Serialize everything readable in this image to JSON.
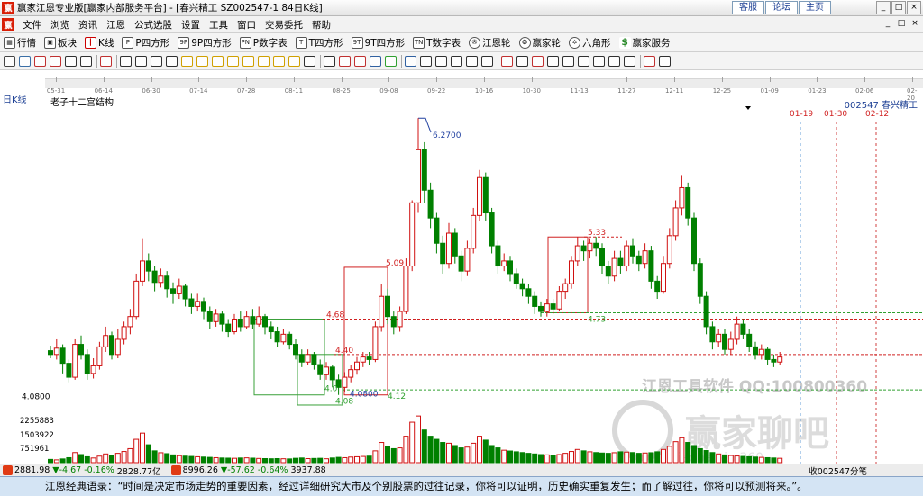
{
  "window": {
    "title": "赢家江恩专业版[赢家内部服务平台] - [春兴精工  SZ002547-1 84日K线]",
    "links": [
      "客服",
      "论坛",
      "主页"
    ],
    "controls": [
      "_",
      "□",
      "×"
    ]
  },
  "menu": {
    "items": [
      "文件",
      "浏览",
      "资讯",
      "江恩",
      "公式选股",
      "设置",
      "工具",
      "窗口",
      "交易委托",
      "帮助"
    ],
    "mdi_controls": [
      "_",
      "□",
      "×"
    ]
  },
  "toolbar": {
    "items": [
      {
        "icon": "grid",
        "label": "行情"
      },
      {
        "icon": "blocks",
        "label": "板块"
      },
      {
        "icon": "kline",
        "label": "K线"
      },
      {
        "icon": "P四",
        "label": "P四方形"
      },
      {
        "icon": "9P",
        "label": "9P四方形"
      },
      {
        "icon": "PN",
        "label": "P数字表"
      },
      {
        "icon": "T",
        "label": "T四方形"
      },
      {
        "icon": "9T",
        "label": "9T四方形"
      },
      {
        "icon": "TN",
        "label": "T数字表"
      },
      {
        "icon": "wheel",
        "label": "江恩轮"
      },
      {
        "icon": "wheel2",
        "label": "赢家轮"
      },
      {
        "icon": "hexagon",
        "label": "六角形"
      },
      {
        "icon": "dollar",
        "label": "赢家服务"
      }
    ]
  },
  "time_axis": {
    "labels": [
      "05-31",
      "06-14",
      "06-30",
      "07-14",
      "07-28",
      "08-11",
      "08-25",
      "09-08",
      "09-22",
      "10-16",
      "10-30",
      "11-13",
      "11-27",
      "12-11",
      "12-25",
      "01-09",
      "01-23",
      "02-06",
      "02-20"
    ]
  },
  "chart": {
    "period": "日K线",
    "indicator_name": "老子十二宫结构",
    "stock": "002547 春兴精工",
    "high_label": "6.2700",
    "low_label": "4.0800",
    "left_price": "4.0800",
    "dates_right": [
      "01-19",
      "01-30",
      "02-12"
    ],
    "levels": [
      "5.09",
      "4.68",
      "4.40",
      "4.08",
      "4.12",
      "5.33",
      "4.73",
      "4.0"
    ],
    "volume_labels": [
      "2255883",
      "1503922",
      "751961"
    ],
    "watermark": "江恩工具软件  QQ:100800360",
    "forum_watermark": "赢家聊吧",
    "forum_url_fragment": "liaoba.vip.360",
    "colors": {
      "up": "#d01010",
      "down": "#008000",
      "green_box": "#3aa03a",
      "red_box": "#d02020",
      "blue": "#2040a0"
    }
  },
  "chart_data": {
    "type": "candlestick",
    "ticker": "002547",
    "name": "春兴精工",
    "period": "日K线",
    "candles": [
      {
        "o": 4.43,
        "c": 4.4,
        "h": 4.47,
        "l": 4.37
      },
      {
        "o": 4.4,
        "c": 4.45,
        "h": 4.52,
        "l": 4.36
      },
      {
        "o": 4.45,
        "c": 4.33,
        "h": 4.48,
        "l": 4.25
      },
      {
        "o": 4.33,
        "c": 4.22,
        "h": 4.36,
        "l": 4.18
      },
      {
        "o": 4.22,
        "c": 4.48,
        "h": 4.52,
        "l": 4.2
      },
      {
        "o": 4.48,
        "c": 4.4,
        "h": 4.55,
        "l": 4.36
      },
      {
        "o": 4.4,
        "c": 4.25,
        "h": 4.44,
        "l": 4.2
      },
      {
        "o": 4.25,
        "c": 4.31,
        "h": 4.37,
        "l": 4.21
      },
      {
        "o": 4.31,
        "c": 4.46,
        "h": 4.5,
        "l": 4.28
      },
      {
        "o": 4.46,
        "c": 4.55,
        "h": 4.62,
        "l": 4.42
      },
      {
        "o": 4.55,
        "c": 4.4,
        "h": 4.58,
        "l": 4.36
      },
      {
        "o": 4.4,
        "c": 4.52,
        "h": 4.6,
        "l": 4.37
      },
      {
        "o": 4.52,
        "c": 4.62,
        "h": 4.66,
        "l": 4.48
      },
      {
        "o": 4.62,
        "c": 4.7,
        "h": 4.76,
        "l": 4.56
      },
      {
        "o": 4.7,
        "c": 4.98,
        "h": 5.04,
        "l": 4.68
      },
      {
        "o": 4.98,
        "c": 5.14,
        "h": 5.32,
        "l": 4.94
      },
      {
        "o": 5.14,
        "c": 5.06,
        "h": 5.2,
        "l": 4.98
      },
      {
        "o": 5.06,
        "c": 4.97,
        "h": 5.1,
        "l": 4.9
      },
      {
        "o": 4.97,
        "c": 5.02,
        "h": 5.08,
        "l": 4.93
      },
      {
        "o": 5.02,
        "c": 4.92,
        "h": 5.06,
        "l": 4.85
      },
      {
        "o": 4.92,
        "c": 4.88,
        "h": 4.97,
        "l": 4.8
      },
      {
        "o": 4.88,
        "c": 4.94,
        "h": 5.0,
        "l": 4.84
      },
      {
        "o": 4.94,
        "c": 4.84,
        "h": 4.96,
        "l": 4.78
      },
      {
        "o": 4.84,
        "c": 4.78,
        "h": 4.88,
        "l": 4.72
      },
      {
        "o": 4.78,
        "c": 4.82,
        "h": 4.88,
        "l": 4.74
      },
      {
        "o": 4.82,
        "c": 4.74,
        "h": 4.85,
        "l": 4.68
      },
      {
        "o": 4.74,
        "c": 4.66,
        "h": 4.78,
        "l": 4.6
      },
      {
        "o": 4.66,
        "c": 4.72,
        "h": 4.76,
        "l": 4.62
      },
      {
        "o": 4.72,
        "c": 4.64,
        "h": 4.74,
        "l": 4.58
      },
      {
        "o": 4.64,
        "c": 4.58,
        "h": 4.68,
        "l": 4.54
      },
      {
        "o": 4.58,
        "c": 4.68,
        "h": 4.72,
        "l": 4.56
      },
      {
        "o": 4.68,
        "c": 4.62,
        "h": 4.74,
        "l": 4.58
      },
      {
        "o": 4.62,
        "c": 4.7,
        "h": 4.74,
        "l": 4.6
      },
      {
        "o": 4.7,
        "c": 4.64,
        "h": 4.76,
        "l": 4.6
      },
      {
        "o": 4.64,
        "c": 4.7,
        "h": 4.78,
        "l": 4.62
      },
      {
        "o": 4.7,
        "c": 4.62,
        "h": 4.72,
        "l": 4.56
      },
      {
        "o": 4.62,
        "c": 4.58,
        "h": 4.66,
        "l": 4.52
      },
      {
        "o": 4.58,
        "c": 4.5,
        "h": 4.62,
        "l": 4.46
      },
      {
        "o": 4.5,
        "c": 4.56,
        "h": 4.6,
        "l": 4.48
      },
      {
        "o": 4.56,
        "c": 4.48,
        "h": 4.58,
        "l": 4.44
      },
      {
        "o": 4.48,
        "c": 4.4,
        "h": 4.52,
        "l": 4.36
      },
      {
        "o": 4.4,
        "c": 4.34,
        "h": 4.44,
        "l": 4.3
      },
      {
        "o": 4.34,
        "c": 4.4,
        "h": 4.44,
        "l": 4.32
      },
      {
        "o": 4.4,
        "c": 4.32,
        "h": 4.42,
        "l": 4.28
      },
      {
        "o": 4.32,
        "c": 4.24,
        "h": 4.36,
        "l": 4.2
      },
      {
        "o": 4.24,
        "c": 4.3,
        "h": 4.34,
        "l": 4.2
      },
      {
        "o": 4.3,
        "c": 4.2,
        "h": 4.32,
        "l": 4.14
      },
      {
        "o": 4.2,
        "c": 4.14,
        "h": 4.24,
        "l": 4.08
      },
      {
        "o": 4.14,
        "c": 4.22,
        "h": 4.26,
        "l": 4.1
      },
      {
        "o": 4.22,
        "c": 4.28,
        "h": 4.32,
        "l": 4.18
      },
      {
        "o": 4.28,
        "c": 4.34,
        "h": 4.38,
        "l": 4.24
      },
      {
        "o": 4.34,
        "c": 4.38,
        "h": 4.42,
        "l": 4.3
      },
      {
        "o": 4.38,
        "c": 4.36,
        "h": 4.42,
        "l": 4.32
      },
      {
        "o": 4.36,
        "c": 4.62,
        "h": 4.66,
        "l": 4.34
      },
      {
        "o": 4.62,
        "c": 4.86,
        "h": 4.96,
        "l": 4.58
      },
      {
        "o": 4.86,
        "c": 4.7,
        "h": 4.92,
        "l": 4.64
      },
      {
        "o": 4.7,
        "c": 4.62,
        "h": 4.74,
        "l": 4.56
      },
      {
        "o": 4.62,
        "c": 4.74,
        "h": 4.78,
        "l": 4.58
      },
      {
        "o": 4.74,
        "c": 5.1,
        "h": 5.16,
        "l": 4.72
      },
      {
        "o": 5.1,
        "c": 5.6,
        "h": 5.62,
        "l": 5.06
      },
      {
        "o": 5.6,
        "c": 6.02,
        "h": 6.27,
        "l": 5.52
      },
      {
        "o": 6.02,
        "c": 5.7,
        "h": 6.08,
        "l": 5.6
      },
      {
        "o": 5.7,
        "c": 5.48,
        "h": 5.76,
        "l": 5.4
      },
      {
        "o": 5.48,
        "c": 5.28,
        "h": 5.52,
        "l": 5.2
      },
      {
        "o": 5.28,
        "c": 5.12,
        "h": 5.34,
        "l": 5.04
      },
      {
        "o": 5.12,
        "c": 5.36,
        "h": 5.44,
        "l": 5.08
      },
      {
        "o": 5.36,
        "c": 5.18,
        "h": 5.4,
        "l": 5.12
      },
      {
        "o": 5.18,
        "c": 5.06,
        "h": 5.22,
        "l": 4.98
      },
      {
        "o": 5.06,
        "c": 5.24,
        "h": 5.3,
        "l": 5.02
      },
      {
        "o": 5.24,
        "c": 5.5,
        "h": 5.56,
        "l": 5.2
      },
      {
        "o": 5.5,
        "c": 5.8,
        "h": 5.86,
        "l": 5.46
      },
      {
        "o": 5.8,
        "c": 5.52,
        "h": 5.84,
        "l": 5.46
      },
      {
        "o": 5.52,
        "c": 5.26,
        "h": 5.56,
        "l": 5.2
      },
      {
        "o": 5.26,
        "c": 5.1,
        "h": 5.3,
        "l": 5.04
      },
      {
        "o": 5.1,
        "c": 5.14,
        "h": 5.2,
        "l": 5.06
      },
      {
        "o": 5.14,
        "c": 5.04,
        "h": 5.18,
        "l": 4.98
      },
      {
        "o": 5.04,
        "c": 4.96,
        "h": 5.08,
        "l": 4.92
      },
      {
        "o": 4.96,
        "c": 4.92,
        "h": 5.0,
        "l": 4.86
      },
      {
        "o": 4.92,
        "c": 4.86,
        "h": 4.96,
        "l": 4.8
      },
      {
        "o": 4.86,
        "c": 4.78,
        "h": 4.9,
        "l": 4.72
      },
      {
        "o": 4.78,
        "c": 4.74,
        "h": 4.82,
        "l": 4.7
      },
      {
        "o": 4.74,
        "c": 4.8,
        "h": 4.84,
        "l": 4.7
      },
      {
        "o": 4.8,
        "c": 4.76,
        "h": 4.84,
        "l": 4.72
      },
      {
        "o": 4.76,
        "c": 4.9,
        "h": 4.94,
        "l": 4.74
      },
      {
        "o": 4.9,
        "c": 4.96,
        "h": 5.0,
        "l": 4.84
      },
      {
        "o": 4.96,
        "c": 5.14,
        "h": 5.18,
        "l": 4.92
      },
      {
        "o": 5.14,
        "c": 5.26,
        "h": 5.33,
        "l": 5.1
      },
      {
        "o": 5.26,
        "c": 5.22,
        "h": 5.3,
        "l": 5.14
      },
      {
        "o": 5.22,
        "c": 5.28,
        "h": 5.32,
        "l": 5.16
      },
      {
        "o": 5.28,
        "c": 5.24,
        "h": 5.33,
        "l": 5.18
      },
      {
        "o": 5.24,
        "c": 5.1,
        "h": 5.28,
        "l": 5.04
      },
      {
        "o": 5.1,
        "c": 5.02,
        "h": 5.14,
        "l": 4.96
      },
      {
        "o": 5.02,
        "c": 5.16,
        "h": 5.22,
        "l": 4.98
      },
      {
        "o": 5.16,
        "c": 5.1,
        "h": 5.22,
        "l": 5.04
      },
      {
        "o": 5.1,
        "c": 5.26,
        "h": 5.3,
        "l": 5.06
      },
      {
        "o": 5.26,
        "c": 5.18,
        "h": 5.32,
        "l": 5.12
      },
      {
        "o": 5.18,
        "c": 5.12,
        "h": 5.22,
        "l": 5.06
      },
      {
        "o": 5.12,
        "c": 5.22,
        "h": 5.28,
        "l": 5.08
      },
      {
        "o": 5.22,
        "c": 4.98,
        "h": 5.26,
        "l": 4.92
      },
      {
        "o": 4.98,
        "c": 4.9,
        "h": 5.02,
        "l": 4.84
      },
      {
        "o": 4.9,
        "c": 5.12,
        "h": 5.18,
        "l": 4.88
      },
      {
        "o": 5.12,
        "c": 5.34,
        "h": 5.4,
        "l": 5.08
      },
      {
        "o": 5.34,
        "c": 5.56,
        "h": 5.62,
        "l": 5.3
      },
      {
        "o": 5.56,
        "c": 5.72,
        "h": 5.82,
        "l": 5.5
      },
      {
        "o": 5.72,
        "c": 5.48,
        "h": 5.76,
        "l": 5.42
      },
      {
        "o": 5.48,
        "c": 5.12,
        "h": 5.52,
        "l": 5.06
      },
      {
        "o": 5.12,
        "c": 4.86,
        "h": 5.16,
        "l": 4.8
      },
      {
        "o": 4.86,
        "c": 4.62,
        "h": 4.9,
        "l": 4.56
      },
      {
        "o": 4.62,
        "c": 4.5,
        "h": 4.66,
        "l": 4.44
      },
      {
        "o": 4.5,
        "c": 4.56,
        "h": 4.6,
        "l": 4.46
      },
      {
        "o": 4.56,
        "c": 4.44,
        "h": 4.6,
        "l": 4.4
      },
      {
        "o": 4.44,
        "c": 4.52,
        "h": 4.58,
        "l": 4.4
      },
      {
        "o": 4.52,
        "c": 4.64,
        "h": 4.7,
        "l": 4.48
      },
      {
        "o": 4.64,
        "c": 4.56,
        "h": 4.68,
        "l": 4.52
      },
      {
        "o": 4.56,
        "c": 4.46,
        "h": 4.6,
        "l": 4.42
      },
      {
        "o": 4.46,
        "c": 4.4,
        "h": 4.5,
        "l": 4.36
      },
      {
        "o": 4.4,
        "c": 4.44,
        "h": 4.48,
        "l": 4.36
      },
      {
        "o": 4.44,
        "c": 4.36,
        "h": 4.46,
        "l": 4.32
      },
      {
        "o": 4.36,
        "c": 4.34,
        "h": 4.4,
        "l": 4.3
      },
      {
        "o": 4.34,
        "c": 4.38,
        "h": 4.42,
        "l": 4.32
      }
    ],
    "volume_unit": "shares",
    "volume_ticks": [
      2255883,
      1503922,
      751961
    ],
    "volume_ylim": [
      0,
      3007844
    ],
    "volumes": [
      210000,
      180000,
      240000,
      320000,
      650000,
      520000,
      380000,
      300000,
      420000,
      560000,
      480000,
      600000,
      720000,
      900000,
      1500000,
      1900000,
      1150000,
      760000,
      640000,
      580000,
      500000,
      450000,
      420000,
      400000,
      380000,
      360000,
      340000,
      320000,
      300000,
      290000,
      280000,
      300000,
      310000,
      290000,
      270000,
      260000,
      250000,
      260000,
      250000,
      240000,
      280000,
      300000,
      260000,
      270000,
      280000,
      250000,
      300000,
      340000,
      320000,
      360000,
      380000,
      400000,
      420000,
      760000,
      1300000,
      1050000,
      900000,
      950000,
      1700000,
      2600000,
      3000000,
      2100000,
      1700000,
      1500000,
      1300000,
      1250000,
      1100000,
      950000,
      1000000,
      1250000,
      1700000,
      1450000,
      1100000,
      950000,
      800000,
      750000,
      700000,
      650000,
      600000,
      560000,
      520000,
      500000,
      480000,
      520000,
      600000,
      720000,
      850000,
      760000,
      700000,
      650000,
      620000,
      600000,
      640000,
      700000,
      680000,
      650000,
      600000,
      620000,
      640000,
      700000,
      850000,
      1050000,
      1350000,
      1600000,
      1300000,
      1100000,
      900000,
      780000,
      650000,
      560000,
      500000,
      460000,
      430000,
      400000,
      380000,
      360000,
      340000,
      320000,
      300000,
      280000
    ],
    "ylim": [
      3.95,
      6.35
    ],
    "title": "老子十二宫结构",
    "xlabels": [
      "05-31",
      "06-14",
      "06-30",
      "07-14",
      "07-28",
      "08-11",
      "08-25",
      "09-08",
      "09-22",
      "10-16",
      "10-30",
      "11-13",
      "11-27",
      "12-11",
      "12-25",
      "01-09",
      "01-23",
      "02-06",
      "02-20"
    ]
  },
  "statusbar": {
    "index1_value": "2881.98",
    "index1_change": "▼-4.67",
    "index1_pct": "-0.16%",
    "index1_amount": "2828.77亿",
    "index2_value": "8996.26",
    "index2_change": "▼-57.62",
    "index2_pct": "-0.64%",
    "index2_amount": "3937.88",
    "right_text": "收002547分笔"
  },
  "quote": {
    "text": "江恩经典语录：“时间是决定市场走势的重要因素，经过详细研究大市及个别股票的过往记录，你将可以证明，历史确实重复发生；而了解过往，你将可以预测将来。”。"
  }
}
